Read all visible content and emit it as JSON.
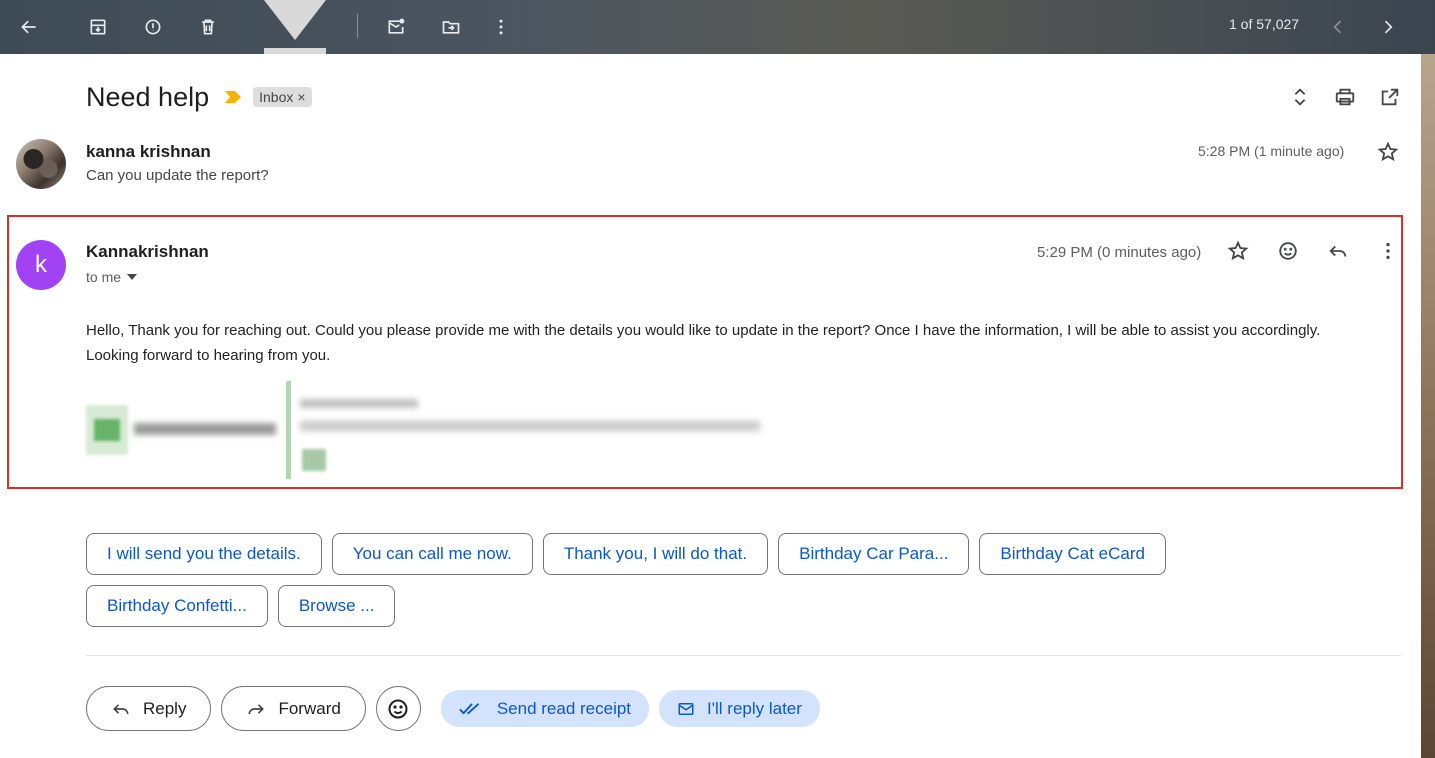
{
  "toolbar": {
    "pager_text": "1 of 57,027"
  },
  "thread": {
    "subject": "Need help",
    "label": "Inbox",
    "label_remove": "×"
  },
  "message1": {
    "sender": "kanna krishnan",
    "snippet": "Can you update the report?",
    "time": "5:28 PM (1 minute ago)"
  },
  "message2": {
    "avatar_letter": "k",
    "avatar_color": "#a142f4",
    "sender": "Kannakrishnan",
    "to": "to me",
    "time": "5:29 PM (0 minutes ago)",
    "body": "Hello, Thank you for reaching out. Could you please provide me with the details you would like to update in the report? Once I have the information, I will be able to assist you accordingly. Looking forward to hearing from you."
  },
  "smart_replies": [
    "I will send you the details.",
    "You can call me now.",
    "Thank you, I will do that.",
    "Birthday Car Para...",
    "Birthday Cat eCard",
    "Birthday Confetti...",
    "Browse ..."
  ],
  "actions": {
    "reply": "Reply",
    "forward": "Forward",
    "send_read_receipt": "Send read receipt",
    "reply_later": "I'll reply later"
  },
  "colors": {
    "highlight_border": "#d93025",
    "link_blue": "#0b57d0",
    "pill_bg": "#d3e3fd"
  }
}
